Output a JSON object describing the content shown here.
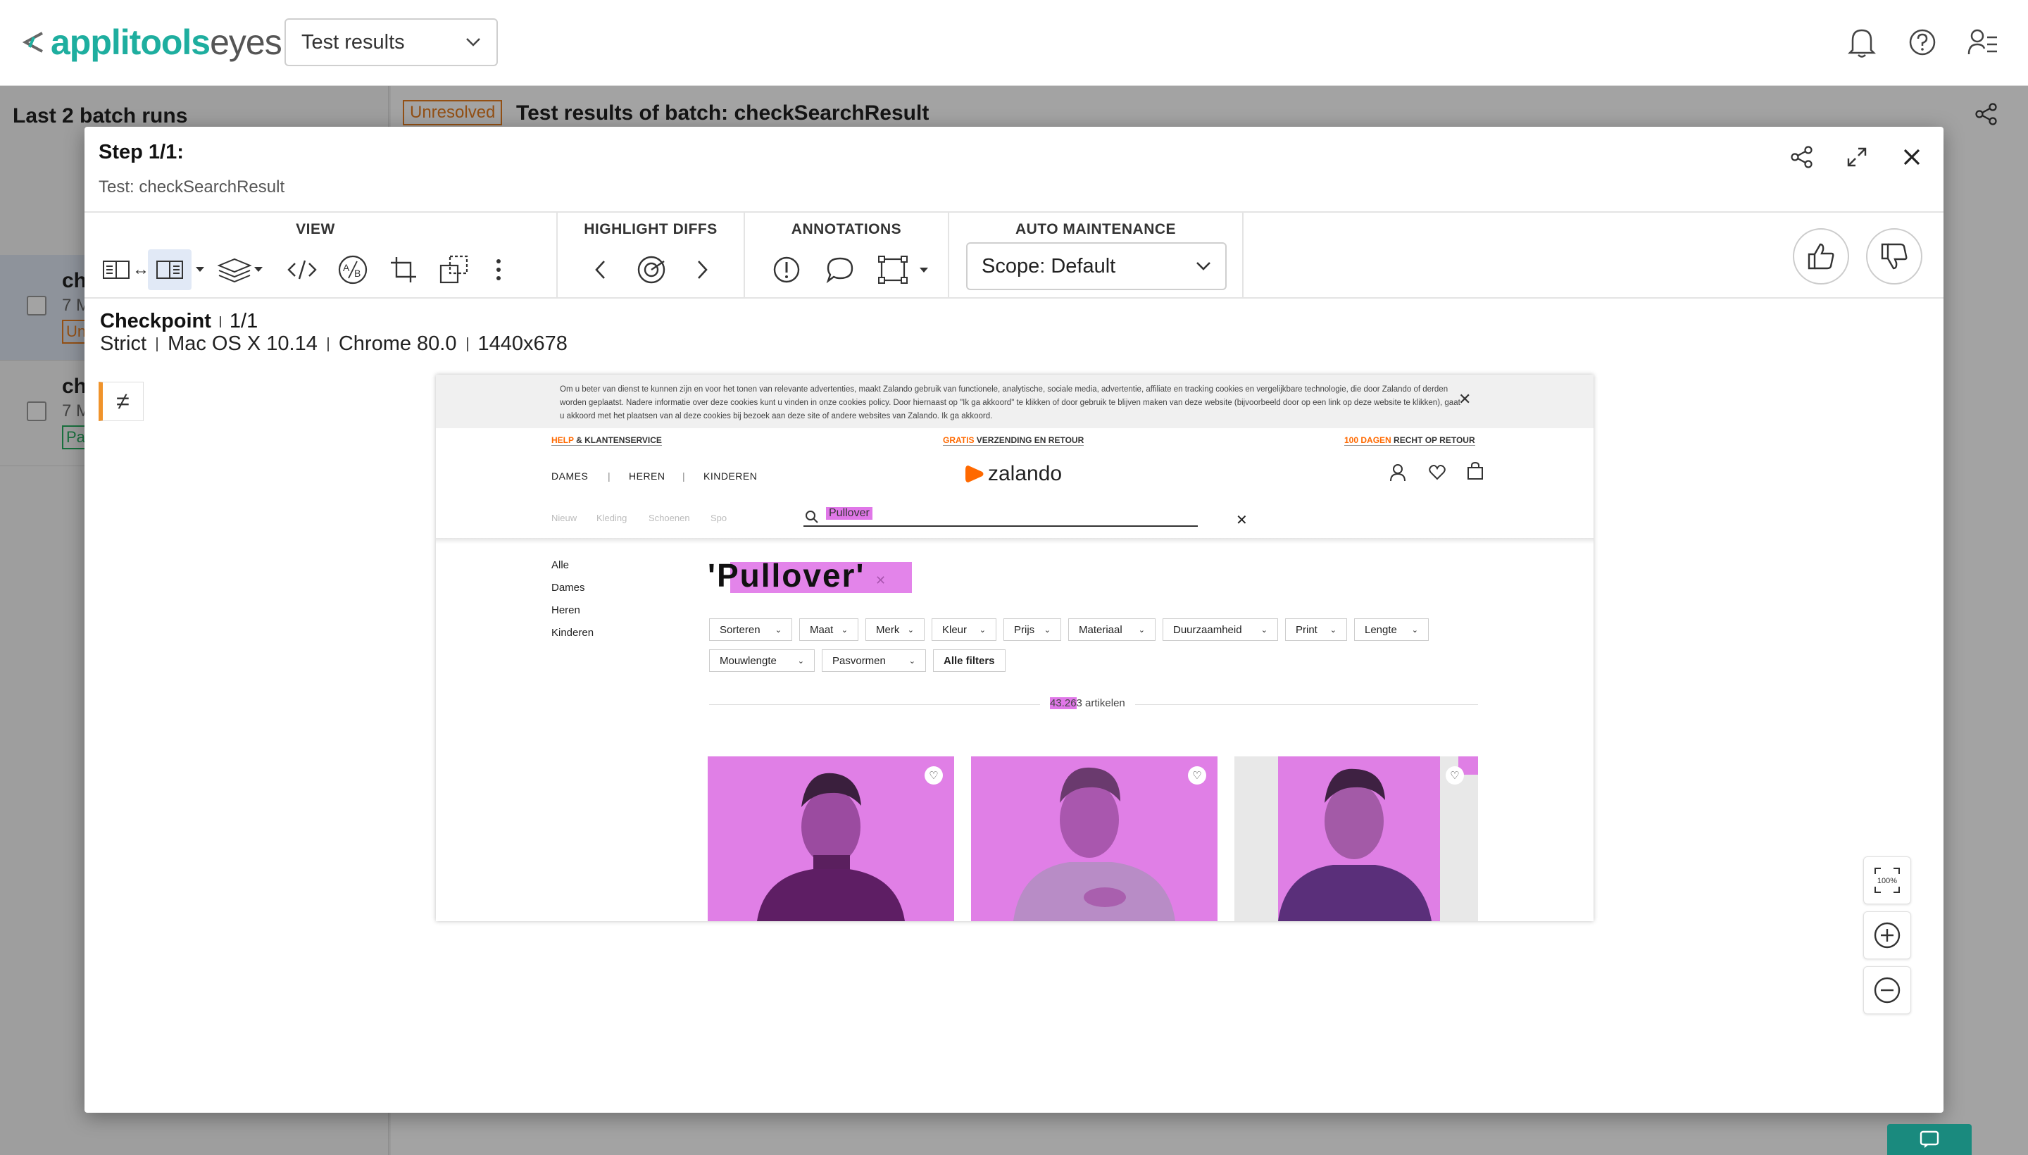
{
  "app": {
    "brand_part1": "applitools",
    "brand_part2": "eyes",
    "view_select": "Test results"
  },
  "background": {
    "left_title": "Last 2 batch runs",
    "row1_name": "ch",
    "row1_meta": "7 M",
    "row1_badge": "Un",
    "row2_name": "ch",
    "row2_meta": "7 M",
    "row2_badge": "Pa",
    "status_tag": "Unresolved",
    "header_title": "Test results of batch: checkSearchResult"
  },
  "modal": {
    "step_title": "Step 1/1:",
    "test_name": "Test: checkSearchResult",
    "toolbar": {
      "view_label": "VIEW",
      "highlight_label": "HIGHLIGHT DIFFS",
      "annotations_label": "ANNOTATIONS",
      "auto_label": "AUTO MAINTENANCE",
      "scope_value": "Scope: Default"
    },
    "checkpoint": {
      "label": "Checkpoint",
      "index": "1/1",
      "match_level": "Strict",
      "os": "Mac OS X 10.14",
      "browser": "Chrome 80.0",
      "viewport": "1440x678"
    },
    "diff_badge": "≠",
    "zoom_100": "100%"
  },
  "screenshot": {
    "cookie_text": "Om u beter van dienst te kunnen zijn en voor het tonen van relevante advertenties, maakt Zalando gebruik van functionele, analytische, sociale media, advertentie, affiliate en tracking cookies en vergelijkbare technologie, die door Zalando of derden worden geplaatst. Nadere informatie over deze cookies kunt u vinden in onze cookies policy. Door hiernaast op \"Ik ga akkoord\" te klikken of door gebruik te blijven maken van deze website (bijvoorbeeld door op een link op deze website te klikken), gaat u akkoord met het plaatsen van al deze cookies bij bezoek aan deze site of andere websites van Zalando. Ik ga akkoord.",
    "usp_help_a": "HELP",
    "usp_help_b": "& KLANTENSERVICE",
    "usp_free_a": "GRATIS",
    "usp_free_b": "VERZENDING EN RETOUR",
    "usp_return_a": "100 DAGEN",
    "usp_return_b": "RECHT OP RETOUR",
    "nav": [
      "DAMES",
      "HEREN",
      "KINDEREN"
    ],
    "brand": "zalando",
    "subnav": [
      "Nieuw",
      "Kleding",
      "Schoenen",
      "Spo"
    ],
    "search_value": "Pullover",
    "categories": [
      "Alle",
      "Dames",
      "Heren",
      "Kinderen"
    ],
    "title": "'Pullover'",
    "filters_row1": [
      "Sorteren",
      "Maat",
      "Merk",
      "Kleur",
      "Prijs",
      "Materiaal",
      "Duurzaamheid",
      "Print",
      "Lengte"
    ],
    "filters_row2": [
      "Mouwlengte",
      "Pasvormen"
    ],
    "all_filters": "Alle filters",
    "count_hl": "43.26",
    "count_rest": "3 artikelen"
  },
  "colors": {
    "brand_teal": "#1eae9f",
    "diff_magenta": "#e077e8",
    "unresolved_orange": "#e67e22",
    "zalando_orange": "#ff6900"
  }
}
